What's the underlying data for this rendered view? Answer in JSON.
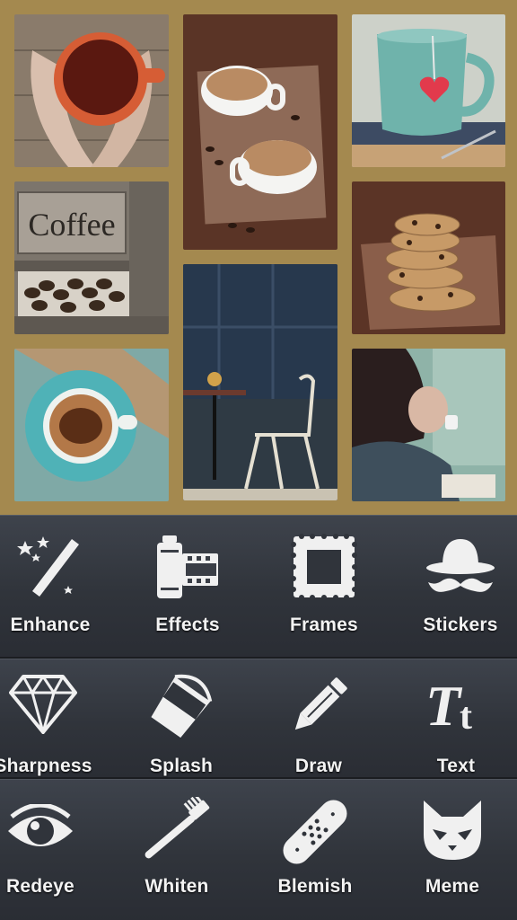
{
  "collage": {
    "photos": [
      {
        "name": "hands-holding-red-mug"
      },
      {
        "name": "two-coffee-cups-on-napkin"
      },
      {
        "name": "teal-mug-with-heart-tag"
      },
      {
        "name": "coffee-sign-with-beans"
      },
      {
        "name": "stacked-cookies"
      },
      {
        "name": "cafe-chairs-by-window"
      },
      {
        "name": "teal-cup-top-view"
      },
      {
        "name": "woman-drinking-coffee"
      }
    ],
    "colors": {
      "border": "#a4894f"
    }
  },
  "sign_text": "Coffee",
  "tools": {
    "row1": [
      {
        "label": "Enhance",
        "icon": "magic-wand-icon"
      },
      {
        "label": "Effects",
        "icon": "film-canister-icon"
      },
      {
        "label": "Frames",
        "icon": "stamp-frame-icon"
      },
      {
        "label": "Stickers",
        "icon": "hat-mustache-icon"
      }
    ],
    "row2": [
      {
        "label": "Sharpness",
        "icon": "diamond-icon"
      },
      {
        "label": "Splash",
        "icon": "paint-bucket-icon"
      },
      {
        "label": "Draw",
        "icon": "pencil-icon"
      },
      {
        "label": "Text",
        "icon": "text-tt-icon"
      }
    ],
    "row3": [
      {
        "label": "Redeye",
        "icon": "eye-icon"
      },
      {
        "label": "Whiten",
        "icon": "toothbrush-icon"
      },
      {
        "label": "Blemish",
        "icon": "bandage-icon"
      },
      {
        "label": "Meme",
        "icon": "cat-face-icon"
      }
    ]
  },
  "colors": {
    "toolbar": "#30343b",
    "label": "#f3f3f3",
    "icon": "#f0f0f0"
  }
}
